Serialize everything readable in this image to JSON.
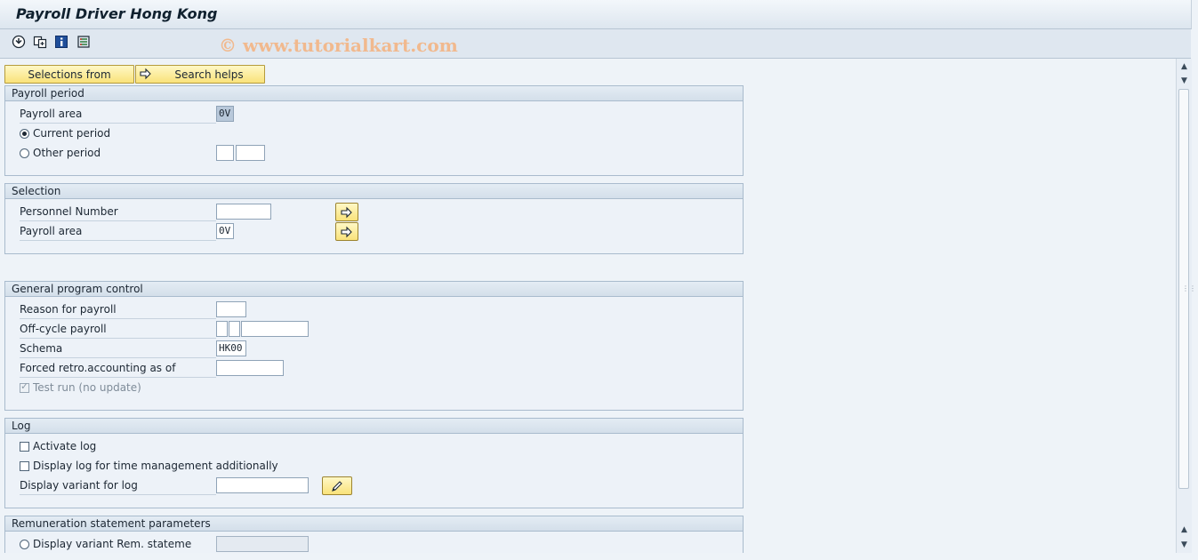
{
  "window": {
    "title": "Payroll Driver Hong Kong"
  },
  "toolbar": {
    "icons": [
      "execute-icon",
      "get-variant-icon",
      "program-info-icon",
      "selection-screen-icon"
    ],
    "watermark": "© www.tutorialkart.com"
  },
  "buttons": {
    "selections_from": "Selections from",
    "search_helps": "Search helps"
  },
  "payroll_period": {
    "title": "Payroll period",
    "payroll_area_label": "Payroll area",
    "payroll_area_value": "0V",
    "current_period_label": "Current period",
    "other_period_label": "Other period",
    "current_period_selected": true
  },
  "selection": {
    "title": "Selection",
    "personnel_number_label": "Personnel Number",
    "personnel_number_value": "",
    "payroll_area_label": "Payroll area",
    "payroll_area_value": "0V"
  },
  "general": {
    "title": "General program control",
    "reason_label": "Reason for payroll",
    "offcycle_label": "Off-cycle payroll",
    "schema_label": "Schema",
    "schema_value": "HK00",
    "forced_retro_label": "Forced retro.accounting as of",
    "test_run_label": "Test run (no update)",
    "test_run_checked": true
  },
  "log": {
    "title": "Log",
    "activate_log_label": "Activate log",
    "display_time_mgmt_label": "Display log for time management additionally",
    "display_variant_label": "Display variant for log"
  },
  "remuneration": {
    "title": "Remuneration statement parameters",
    "display_variant_label": "Display variant Rem. stateme"
  },
  "colors": {
    "button_yellow": "#f9e27a",
    "background": "#eef3f8",
    "group_border": "#a9bbcd"
  }
}
